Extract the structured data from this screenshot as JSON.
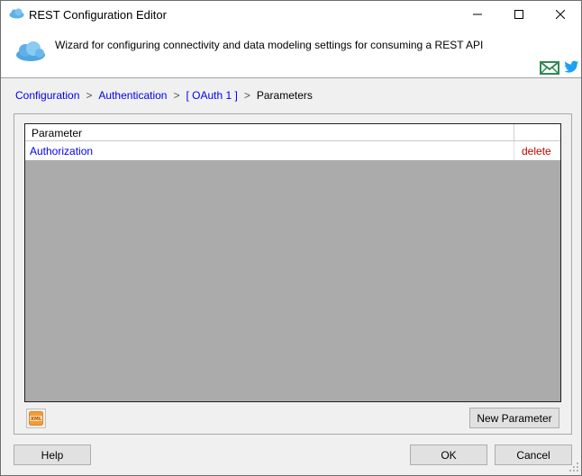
{
  "window": {
    "title": "REST Configuration Editor"
  },
  "header": {
    "description": "Wizard for configuring connectivity and data modeling settings for consuming a REST API"
  },
  "breadcrumb": {
    "items": [
      "Configuration",
      "Authentication",
      "[ OAuth 1 ]",
      "Parameters"
    ],
    "separator": ">"
  },
  "grid": {
    "column_parameter": "Parameter",
    "rows": [
      {
        "name": "Authorization",
        "action": "delete"
      }
    ]
  },
  "buttons": {
    "new_parameter": "New Parameter",
    "help": "Help",
    "ok": "OK",
    "cancel": "Cancel"
  },
  "icons": {
    "app": "cloud-icon",
    "header": "cloud-icon",
    "mail": "mail-icon",
    "twitter": "twitter-icon",
    "xml": "xml-icon"
  },
  "colors": {
    "link": "#0000ee",
    "delete": "#c00000",
    "grid_background": "#ababab",
    "mail": "#2e8b57",
    "twitter": "#1da1f2"
  }
}
